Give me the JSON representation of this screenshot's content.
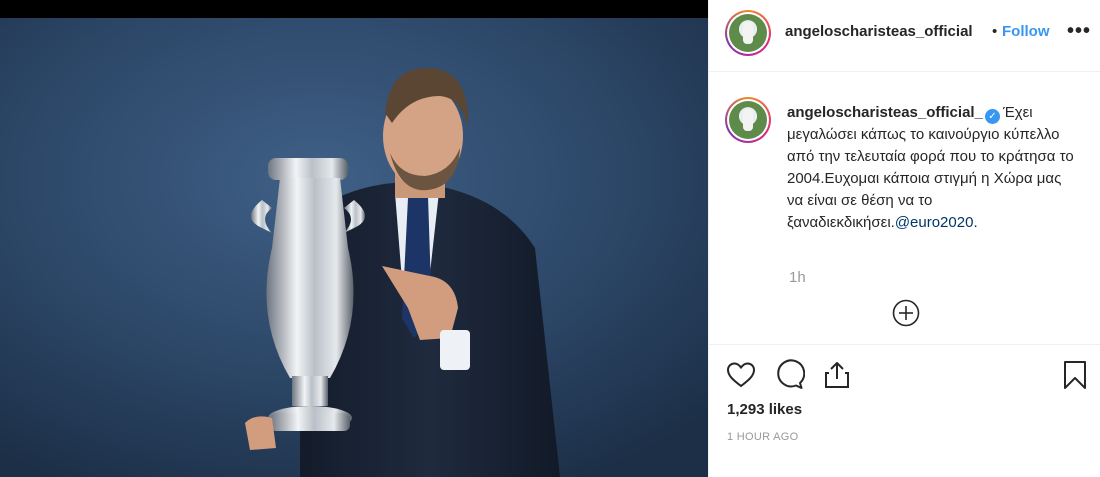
{
  "header": {
    "username": "angeloscharisteas_official",
    "separator": "•",
    "follow_label": "Follow",
    "more_icon": "more-options-icon"
  },
  "caption": {
    "username": "angeloscharisteas_official_",
    "verified_icon": "verified-badge-icon",
    "text": "Έχει μεγαλώσει κάπως το καινούργιο κύπελλο από την τελευταία φορά που το κράτησα το 2004.Ευχομαι κάποια στιγμή η Χώρα μας να είναι σε θέση να το ξαναδιεκδικήσει.",
    "mention": "@euro2020",
    "trailing": ".",
    "time": "1h"
  },
  "actions": {
    "like_icon": "heart-icon",
    "comment_icon": "comment-icon",
    "share_icon": "share-icon",
    "save_icon": "bookmark-icon",
    "likes": "1,293 likes",
    "posted": "1 HOUR AGO"
  },
  "colors": {
    "link": "#3897f0",
    "text": "#262626",
    "muted": "#999999",
    "photo_bg": "#2c4664"
  }
}
